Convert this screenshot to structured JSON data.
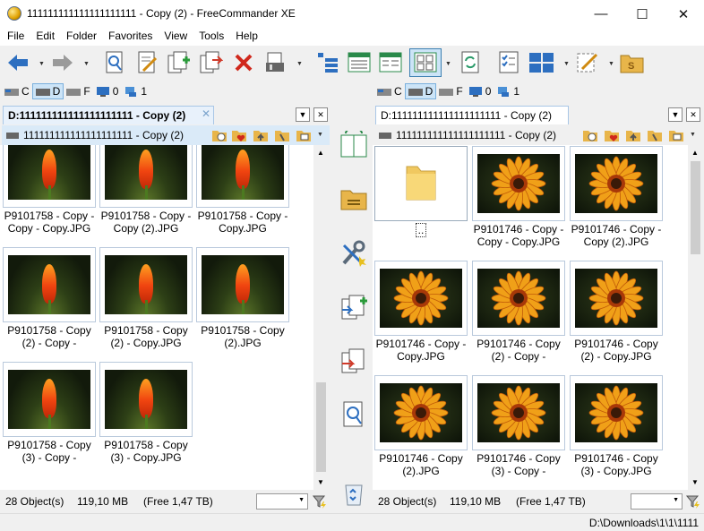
{
  "window": {
    "title": "111111111111111111111 - Copy (2) - FreeCommander XE",
    "controls": {
      "minimize": "—",
      "maximize": "☐",
      "close": "✕"
    }
  },
  "menu": [
    "File",
    "Edit",
    "Folder",
    "Favorites",
    "View",
    "Tools",
    "Help"
  ],
  "drives": [
    {
      "letter": "C",
      "selected": false
    },
    {
      "letter": "D",
      "selected": true
    },
    {
      "letter": "F",
      "selected": false
    },
    {
      "letter": "0",
      "selected": false
    },
    {
      "letter": "1",
      "selected": false
    }
  ],
  "left": {
    "tab": "D:111111111111111111111 - Copy (2)",
    "tab_close": "✕",
    "path": "111111111111111111111 - Copy (2)",
    "files": [
      {
        "name": "P9101758 - Copy - Copy - Copy.JPG",
        "line1": "P9101758 - Copy -",
        "line2": "Copy - Copy.JPG",
        "img": "torch"
      },
      {
        "name": "P9101758 - Copy - Copy (2).JPG",
        "line1": "P9101758 - Copy -",
        "line2": "Copy (2).JPG",
        "img": "torch"
      },
      {
        "name": "P9101758 - Copy - Copy.JPG",
        "line1": "P9101758 - Copy -",
        "line2": "Copy.JPG",
        "img": "torch"
      },
      {
        "name": "P9101758 - Copy (2) - Copy -",
        "line1": "P9101758 - Copy",
        "line2": "(2) - Copy -",
        "img": "torch"
      },
      {
        "name": "P9101758 - Copy (2) - Copy.JPG",
        "line1": "P9101758 - Copy",
        "line2": "(2) - Copy.JPG",
        "img": "torch"
      },
      {
        "name": "P9101758 - Copy (2).JPG",
        "line1": "P9101758 - Copy",
        "line2": "(2).JPG",
        "img": "torch"
      },
      {
        "name": "P9101758 - Copy (3) - Copy -",
        "line1": "P9101758 - Copy",
        "line2": "(3) - Copy -",
        "img": "torch"
      },
      {
        "name": "P9101758 - Copy (3) - Copy.JPG",
        "line1": "P9101758 - Copy",
        "line2": "(3) - Copy.JPG",
        "img": "torch"
      }
    ],
    "status_objects": "28 Object(s)",
    "status_size": "119,10 MB",
    "status_free": "(Free 1,47 TB)"
  },
  "right": {
    "tab": "D:111111111111111111111 - Copy (2)",
    "tab_close": "✕",
    "path": "111111111111111111111 - Copy (2)",
    "files": [
      {
        "name": "..",
        "line1": "..",
        "line2": "",
        "img": "folder"
      },
      {
        "name": "P9101746 - Copy - Copy - Copy.JPG",
        "line1": "P9101746 - Copy -",
        "line2": "Copy - Copy.JPG",
        "img": "daisy"
      },
      {
        "name": "P9101746 - Copy - Copy (2).JPG",
        "line1": "P9101746 - Copy -",
        "line2": "Copy (2).JPG",
        "img": "daisy"
      },
      {
        "name": "P9101746 - Copy - Copy.JPG",
        "line1": "P9101746 - Copy -",
        "line2": "Copy.JPG",
        "img": "daisy"
      },
      {
        "name": "P9101746 - Copy (2) - Copy -",
        "line1": "P9101746 - Copy",
        "line2": "(2) - Copy -",
        "img": "daisy"
      },
      {
        "name": "P9101746 - Copy (2) - Copy.JPG",
        "line1": "P9101746 - Copy",
        "line2": "(2) - Copy.JPG",
        "img": "daisy"
      },
      {
        "name": "P9101746 - Copy (2).JPG",
        "line1": "P9101746 - Copy",
        "line2": "(2).JPG",
        "img": "daisy"
      },
      {
        "name": "P9101746 - Copy (3) - Copy -",
        "line1": "P9101746 - Copy",
        "line2": "(3) - Copy -",
        "img": "daisy"
      },
      {
        "name": "P9101746 - Copy (3) - Copy.JPG",
        "line1": "P9101746 - Copy",
        "line2": "(3) - Copy.JPG",
        "img": "daisy"
      }
    ],
    "status_objects": "28 Object(s)",
    "status_size": "119,10 MB",
    "status_free": "(Free 1,47 TB)"
  },
  "bottom_path": "D:\\Downloads\\1\\1\\1111",
  "colors": {
    "accent": "#3c7fb1",
    "active_path": "#daeaf8",
    "tab_border": "#a9c6e6"
  }
}
